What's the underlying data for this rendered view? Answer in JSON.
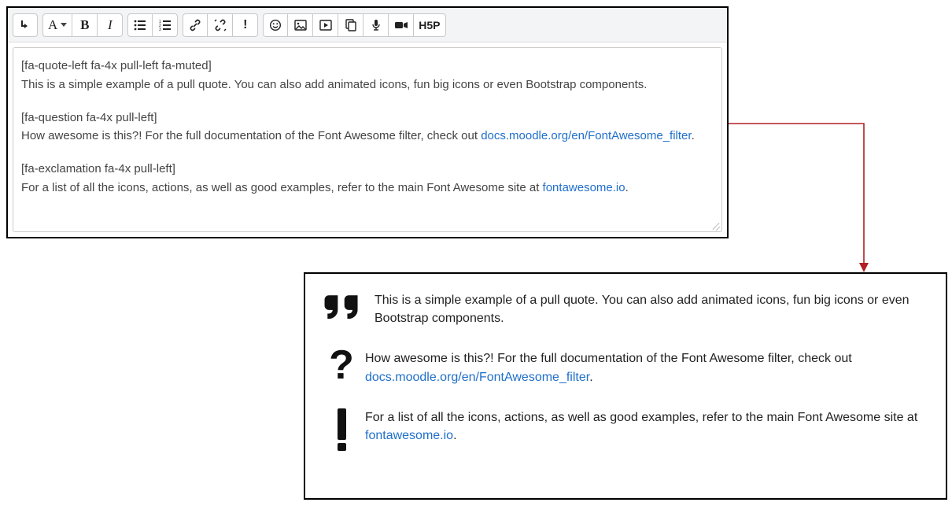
{
  "editor": {
    "toolbar": {
      "toggle": "toggle-toolbar-icon",
      "font": "font-style-picker",
      "bold": "bold-button",
      "italic": "italic-button",
      "ul": "bulleted-list-button",
      "ol": "numbered-list-button",
      "link": "link-button",
      "unlink": "unlink-button",
      "excl": "exclamation-button",
      "emoji": "emoji-button",
      "image": "image-button",
      "media": "media-button",
      "files": "manage-files-button",
      "mic": "record-audio-button",
      "video": "record-video-button",
      "h5p": "H5P"
    },
    "content": {
      "p1a": "[fa-quote-left fa-4x pull-left fa-muted]",
      "p1b": "This is a simple example of a pull quote. You can also add animated icons, fun big icons or even Bootstrap components.",
      "p2a": "[fa-question fa-4x pull-left]",
      "p2b_pre": "How awesome is this?! For the full documentation of the Font Awesome filter, check out ",
      "p2b_link": "docs.moodle.org/en/FontAwesome_filter",
      "p2b_post": ".",
      "p3a": "[fa-exclamation fa-4x pull-left]",
      "p3b_pre": "For a list of all the icons, actions, as well as good examples, refer to the main Font Awesome site at ",
      "p3b_link": "fontawesome.io",
      "p3b_post": "."
    }
  },
  "output": {
    "row1": "This is a simple example of a pull quote. You can also add animated icons, fun big icons or even Bootstrap components.",
    "row2_pre": "How awesome is this?! For the full documentation of the Font Awesome filter, check out ",
    "row2_link": "docs.moodle.org/en/FontAwesome_filter",
    "row2_post": ".",
    "row3_pre": "For a list of all the icons, actions, as well as good examples, refer to the main Font Awesome site at ",
    "row3_link": "fontawesome.io",
    "row3_post": "."
  }
}
